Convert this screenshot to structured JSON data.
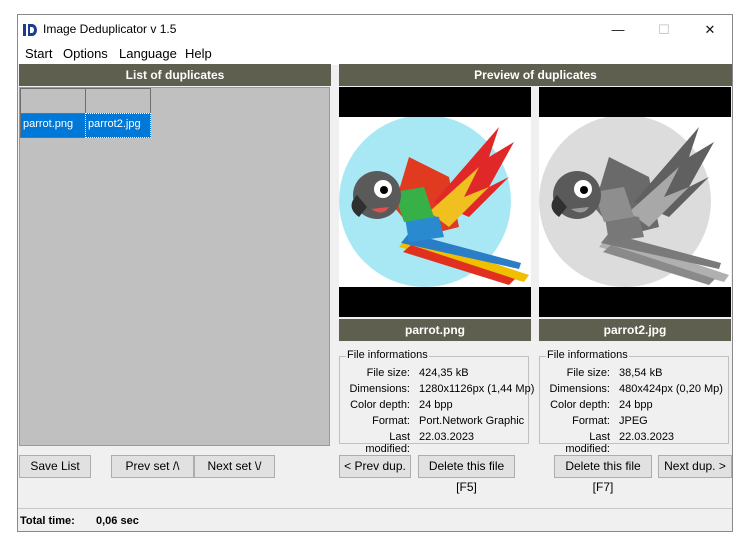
{
  "window": {
    "title": "Image Deduplicator v 1.5",
    "controls": {
      "minimize": "—",
      "maximize": "☐",
      "close": "✕"
    }
  },
  "menu": [
    "Start",
    "Options",
    "Language",
    "Help"
  ],
  "left_panel": {
    "header": "List of duplicates",
    "files": [
      "parrot.png",
      "parrot2.jpg"
    ]
  },
  "right_panel": {
    "header": "Preview of duplicates",
    "left_image": {
      "caption": "parrot.png",
      "info_title": "File informations",
      "file_size": "424,35 kB",
      "dimensions": "1280x1126px (1,44 Mp)",
      "color_depth": "24 bpp",
      "format": "Port.Network Graphic",
      "last_modified": "22.03.2023"
    },
    "right_image": {
      "caption": "parrot2.jpg",
      "info_title": "File informations",
      "file_size": "38,54 kB",
      "dimensions": "480x424px (0,20 Mp)",
      "color_depth": "24 bpp",
      "format": "JPEG",
      "last_modified": "22.03.2023"
    }
  },
  "info_labels": {
    "file_size": "File size:",
    "dimensions": "Dimensions:",
    "color_depth": "Color depth:",
    "format": "Format:",
    "last_modified": "Last modified:"
  },
  "buttons": {
    "save_list": "Save List",
    "prev_set": "Prev set /\\",
    "next_set": "Next set \\/",
    "prev_dup": "< Prev dup.",
    "delete_left": "Delete this file [F5]",
    "delete_right": "Delete this file [F7]",
    "next_dup": "Next dup. >"
  },
  "status": {
    "label": "Total time:",
    "value": "0,06 sec"
  },
  "colors": {
    "header_bg": "#5e5f4f",
    "selected_bg": "#0078d7",
    "list_bg": "#c0c0c0"
  }
}
